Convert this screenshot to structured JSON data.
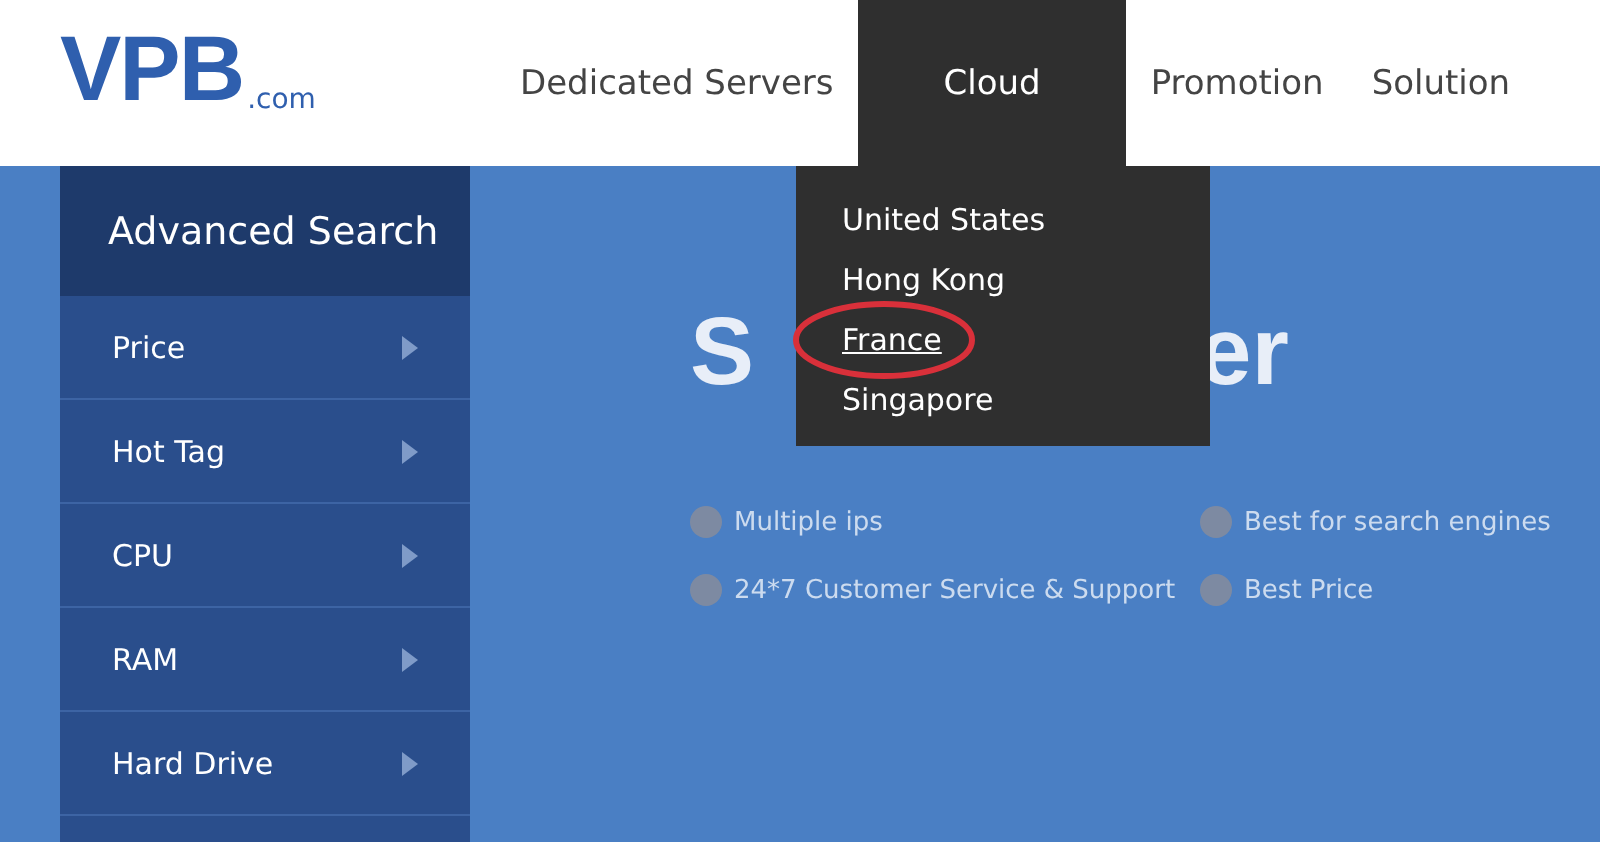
{
  "logo": {
    "mark": "VPB",
    "suffix": ".com"
  },
  "nav": [
    {
      "label": "Dedicated Servers",
      "selected": false
    },
    {
      "label": "Cloud",
      "selected": true
    },
    {
      "label": "Promotion",
      "selected": false
    },
    {
      "label": "Solution",
      "selected": false
    }
  ],
  "dropdown": {
    "items": [
      {
        "label": "United States",
        "highlighted": false
      },
      {
        "label": "Hong Kong",
        "highlighted": false
      },
      {
        "label": "France",
        "highlighted": true
      },
      {
        "label": "Singapore",
        "highlighted": false
      }
    ]
  },
  "sidebar": {
    "title": "Advanced Search",
    "items": [
      "Price",
      "Hot Tag",
      "CPU",
      "RAM",
      "Hard Drive"
    ]
  },
  "hero": {
    "title_start": "S",
    "title_end": "er",
    "features": [
      "Multiple ips",
      "Best for search engines",
      "24*7 Customer Service & Support",
      "Best Price"
    ]
  }
}
